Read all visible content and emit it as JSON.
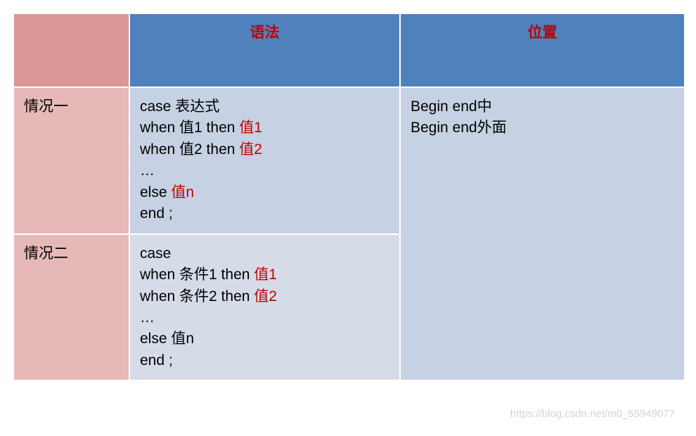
{
  "header": {
    "col_syntax": "语法",
    "col_position": "位置"
  },
  "rows": {
    "case1": {
      "label": "情况一",
      "line1_a": "case  表达式",
      "line2_a": "when 值1 then  ",
      "line2_b": "值1",
      "line3_a": "when 值2 then  ",
      "line3_b": "值2",
      "line4": "…",
      "line5_a": "else  ",
      "line5_b": "值n",
      "line6": "end ;"
    },
    "case2": {
      "label": "情况二",
      "line1": "case",
      "line2_a": "when 条件1 then  ",
      "line2_b": "值1",
      "line3_a": "when 条件2 then ",
      "line3_b": "值2",
      "line4": "…",
      "line5": "else  值n",
      "line6": "end ;"
    },
    "position": {
      "p1": "Begin end中",
      "p2": "Begin end外面"
    }
  },
  "watermark": "https://blog.csdn.net/m0_55949077"
}
